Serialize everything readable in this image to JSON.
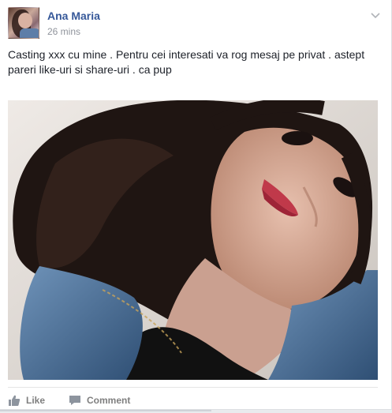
{
  "post": {
    "author": "Ana Maria",
    "timestamp": "26 mins",
    "text": "Casting xxx cu mine . Pentru cei interesati va rog mesaj pe privat . astept pareri like-uri si share-uri . ca pup",
    "photo_subject": "selfie"
  },
  "actions": {
    "like_label": "Like",
    "comment_label": "Comment"
  },
  "icons": {
    "menu": "chevron-down-icon",
    "like": "thumbs-up-icon",
    "comment": "speech-bubble-icon"
  },
  "colors": {
    "name_link": "#365899",
    "meta_text": "#90949c",
    "action_text": "#7f7f7f"
  }
}
